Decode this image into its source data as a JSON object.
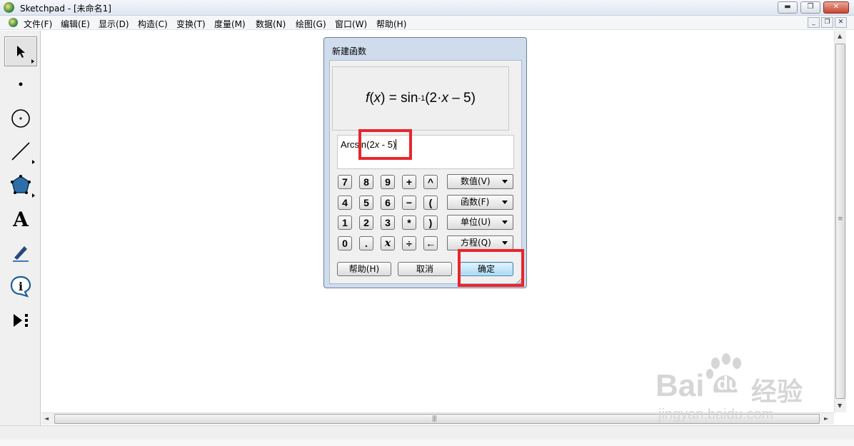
{
  "window": {
    "app_title": "Sketchpad  - [未命名1]",
    "minimize": "▬",
    "maximize": "❐",
    "close": "✕"
  },
  "menu": {
    "items": [
      "文件(F)",
      "编辑(E)",
      "显示(D)",
      "构造(C)",
      "变换(T)",
      "度量(M)",
      "数据(N)",
      "绘图(G)",
      "窗口(W)",
      "帮助(H)"
    ],
    "mdi_minimize": "_",
    "mdi_restore": "❐",
    "mdi_close": "✕"
  },
  "toolbox": {
    "tools": [
      {
        "name": "arrow-tool",
        "icon": "arrow-icon"
      },
      {
        "name": "point-tool",
        "icon": "point-icon"
      },
      {
        "name": "compass-tool",
        "icon": "circle-icon"
      },
      {
        "name": "straightedge-tool",
        "icon": "line-icon"
      },
      {
        "name": "polygon-tool",
        "icon": "pentagon-icon"
      },
      {
        "name": "text-tool",
        "icon": "text-icon",
        "label": "A"
      },
      {
        "name": "marker-tool",
        "icon": "marker-icon"
      },
      {
        "name": "information-tool",
        "icon": "info-icon",
        "label": "i"
      },
      {
        "name": "custom-tool",
        "icon": "custom-tool-icon"
      }
    ]
  },
  "dialog": {
    "title": "新建函数",
    "preview": {
      "f": "f",
      "x": "x",
      "eq": " = sin",
      "sup": "-1",
      "arg_open": "(2·",
      "arg_x": "x",
      "arg_close": " – 5)"
    },
    "expression": {
      "prefix": "Arcsin",
      "paren": "(2",
      "var": "x",
      "suffix": " - 5)"
    },
    "keypad": [
      [
        "7",
        "8",
        "9",
        "+",
        "^"
      ],
      [
        "4",
        "5",
        "6",
        "−",
        "("
      ],
      [
        "1",
        "2",
        "3",
        "*",
        ")"
      ],
      [
        "0",
        ".",
        "x",
        "÷",
        "←"
      ]
    ],
    "dropdowns": [
      "数值(V)",
      "函数(F)",
      "单位(U)",
      "方程(Q)"
    ],
    "buttons": {
      "help": "帮助(H)",
      "cancel": "取消",
      "ok": "确定"
    }
  },
  "scroll": {
    "up": "▲",
    "down": "▼",
    "left": "◄",
    "right": "►",
    "grip": "|||",
    "vgrip": "≡"
  },
  "watermark": {
    "brand_latin": "Bai",
    "brand_du": "du",
    "brand_cn": "经验",
    "url": "jingyan.baidu.com"
  },
  "highlight_color": "#e8252c"
}
